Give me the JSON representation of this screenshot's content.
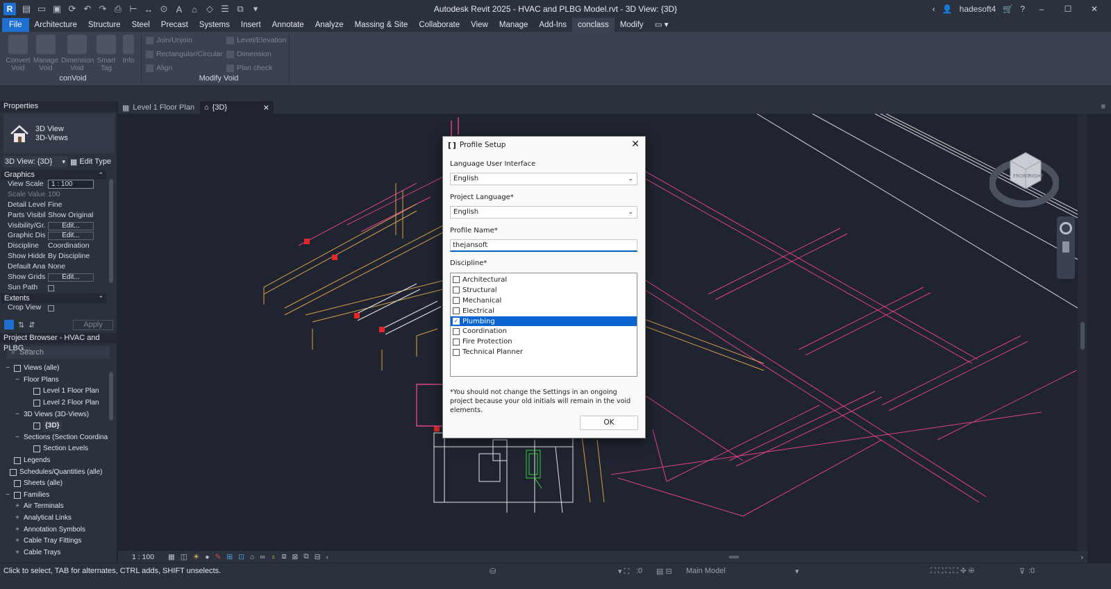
{
  "titlebar": {
    "app_letter": "R",
    "title": "Autodesk Revit 2025 - HVAC and PLBG Model.rvt - 3D View: {3D}",
    "user": "hadesoft4",
    "help": "?"
  },
  "menu": {
    "items": [
      "File",
      "Architecture",
      "Structure",
      "Steel",
      "Precast",
      "Systems",
      "Insert",
      "Annotate",
      "Analyze",
      "Massing & Site",
      "Collaborate",
      "View",
      "Manage",
      "Add-Ins",
      "conclass",
      "Modify"
    ],
    "active": "conclass"
  },
  "ribbon": {
    "convoid_group": "conVoid",
    "modify_group": "Modify Void",
    "big_buttons": [
      {
        "label": "Convert Void"
      },
      {
        "label": "Manage Void"
      },
      {
        "label": "Dimension Void"
      },
      {
        "label": "Smart Tag"
      },
      {
        "label": "Info"
      }
    ],
    "small_buttons": [
      "Join/Unjoin",
      "Rectangular/Circular",
      "Align",
      "Level/Elevation",
      "Dimension",
      "Plan check"
    ]
  },
  "properties": {
    "header": "Properties",
    "type_line1": "3D View",
    "type_line2": "3D-Views",
    "view_selector": "3D View: {3D}",
    "edit_type": "Edit Type",
    "cat_graphics": "Graphics",
    "cat_extents": "Extents",
    "rows": [
      {
        "k": "View Scale",
        "v": "1 : 100"
      },
      {
        "k": "Scale Value ...",
        "v": "100"
      },
      {
        "k": "Detail Level",
        "v": "Fine"
      },
      {
        "k": "Parts Visibility",
        "v": "Show Original"
      },
      {
        "k": "Visibility/Gr...",
        "v": "Edit..."
      },
      {
        "k": "Graphic Dis...",
        "v": "Edit..."
      },
      {
        "k": "Discipline",
        "v": "Coordination"
      },
      {
        "k": "Show Hidde...",
        "v": "By Discipline"
      },
      {
        "k": "Default Anal...",
        "v": "None"
      },
      {
        "k": "Show Grids",
        "v": "Edit..."
      },
      {
        "k": "Sun Path",
        "v": ""
      }
    ],
    "crop_view": "Crop View",
    "apply": "Apply"
  },
  "browser": {
    "header": "Project Browser - HVAC and PLBG...",
    "search_placeholder": "Search",
    "items": [
      {
        "label": "Views (alle)"
      },
      {
        "label": "Floor Plans"
      },
      {
        "label": "Level 1 Floor Plan"
      },
      {
        "label": "Level 2 Floor Plan"
      },
      {
        "label": "3D Views (3D-Views)"
      },
      {
        "label": "{3D}"
      },
      {
        "label": "Sections (Section Coordina"
      },
      {
        "label": "Section Levels"
      },
      {
        "label": "Legends"
      },
      {
        "label": "Schedules/Quantities (alle)"
      },
      {
        "label": "Sheets (alle)"
      },
      {
        "label": "Families"
      },
      {
        "label": "Air Terminals"
      },
      {
        "label": "Analytical Links"
      },
      {
        "label": "Annotation Symbols"
      },
      {
        "label": "Cable Tray Fittings"
      },
      {
        "label": "Cable Trays"
      }
    ]
  },
  "doctabs": {
    "tab1": "Level 1 Floor Plan",
    "tab2": "{3D}"
  },
  "viewstatus": {
    "scale": "1 : 100"
  },
  "statusbar": {
    "hint": "Click to select, TAB for alternates, CTRL adds, SHIFT unselects.",
    "zero1": ":0",
    "model": "Main Model",
    "zero2": ":0"
  },
  "dialog": {
    "title": "Profile Setup",
    "lang_ui_label": "Language User Interface",
    "lang_ui_value": "English",
    "project_lang_label": "Project Language*",
    "project_lang_value": "English",
    "profile_name_label": "Profile Name*",
    "profile_name_value": "thejansoft",
    "discipline_label": "Discipline*",
    "disciplines": [
      {
        "label": "Architectural",
        "checked": false
      },
      {
        "label": "Structural",
        "checked": false
      },
      {
        "label": "Mechanical",
        "checked": false
      },
      {
        "label": "Electrical",
        "checked": false
      },
      {
        "label": "Plumbing",
        "checked": true
      },
      {
        "label": "Coordination",
        "checked": false
      },
      {
        "label": "Fire Protection",
        "checked": false
      },
      {
        "label": "Technical Planner",
        "checked": false
      }
    ],
    "note": "*You should not change the Settings in an ongoing project because your old initials will remain in the void elements.",
    "ok": "OK"
  },
  "viewcube": {
    "face_front": "FRONT",
    "face_right": "RIGHT"
  },
  "colors": {
    "accent": "#1f6fd1",
    "selection": "#0a64d0",
    "pipe_magenta": "#e0408c",
    "duct_orange": "#d9a24a",
    "red_fitting": "#e02a2a",
    "green": "#39d040"
  }
}
